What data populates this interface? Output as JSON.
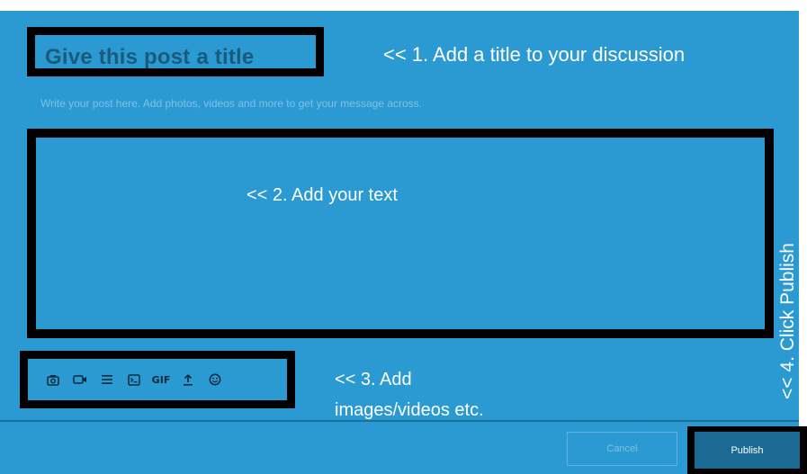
{
  "editor": {
    "title_placeholder": "Give this post a title",
    "body_placeholder": "Write your post here. Add photos, videos and more to get your message across."
  },
  "annotations": {
    "step1": "<< 1. Add a title to your discussion",
    "step2": "<< 2. Add your text",
    "step3": "<< 3. Add images/videos etc.",
    "step4": "<< 4. Click Publish"
  },
  "toolbar": {
    "items": [
      {
        "icon": "camera-icon"
      },
      {
        "icon": "video-icon"
      },
      {
        "icon": "divider-icon"
      },
      {
        "icon": "code-block-icon"
      },
      {
        "icon": "gif-icon",
        "label": "GIF"
      },
      {
        "icon": "upload-icon"
      },
      {
        "icon": "emoji-icon"
      }
    ]
  },
  "footer": {
    "cancel_label": "Cancel",
    "publish_label": "Publish"
  },
  "colors": {
    "panel": "#2b9ad2",
    "highlight_border": "#000000",
    "publish_button": "#1a6a93"
  }
}
